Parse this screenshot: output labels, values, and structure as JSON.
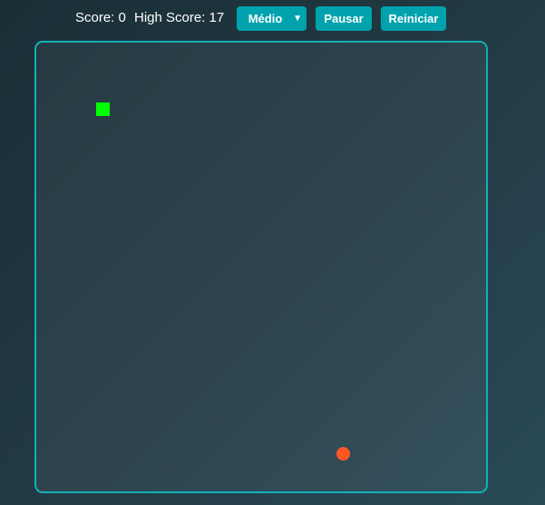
{
  "hud": {
    "score_text": "Score: 0",
    "high_score_text": "High Score: 17",
    "difficulty_selected": "Médio",
    "pause_label": "Pausar",
    "restart_label": "Reiniciar"
  },
  "game": {
    "score": 0,
    "high_score": 17
  },
  "colors": {
    "snake": "#00ff00",
    "food": "#ff5722",
    "accent": "#00a3ad",
    "board_border": "#12b0b8"
  },
  "icons": {
    "dropdown": "chevron-down-icon"
  }
}
